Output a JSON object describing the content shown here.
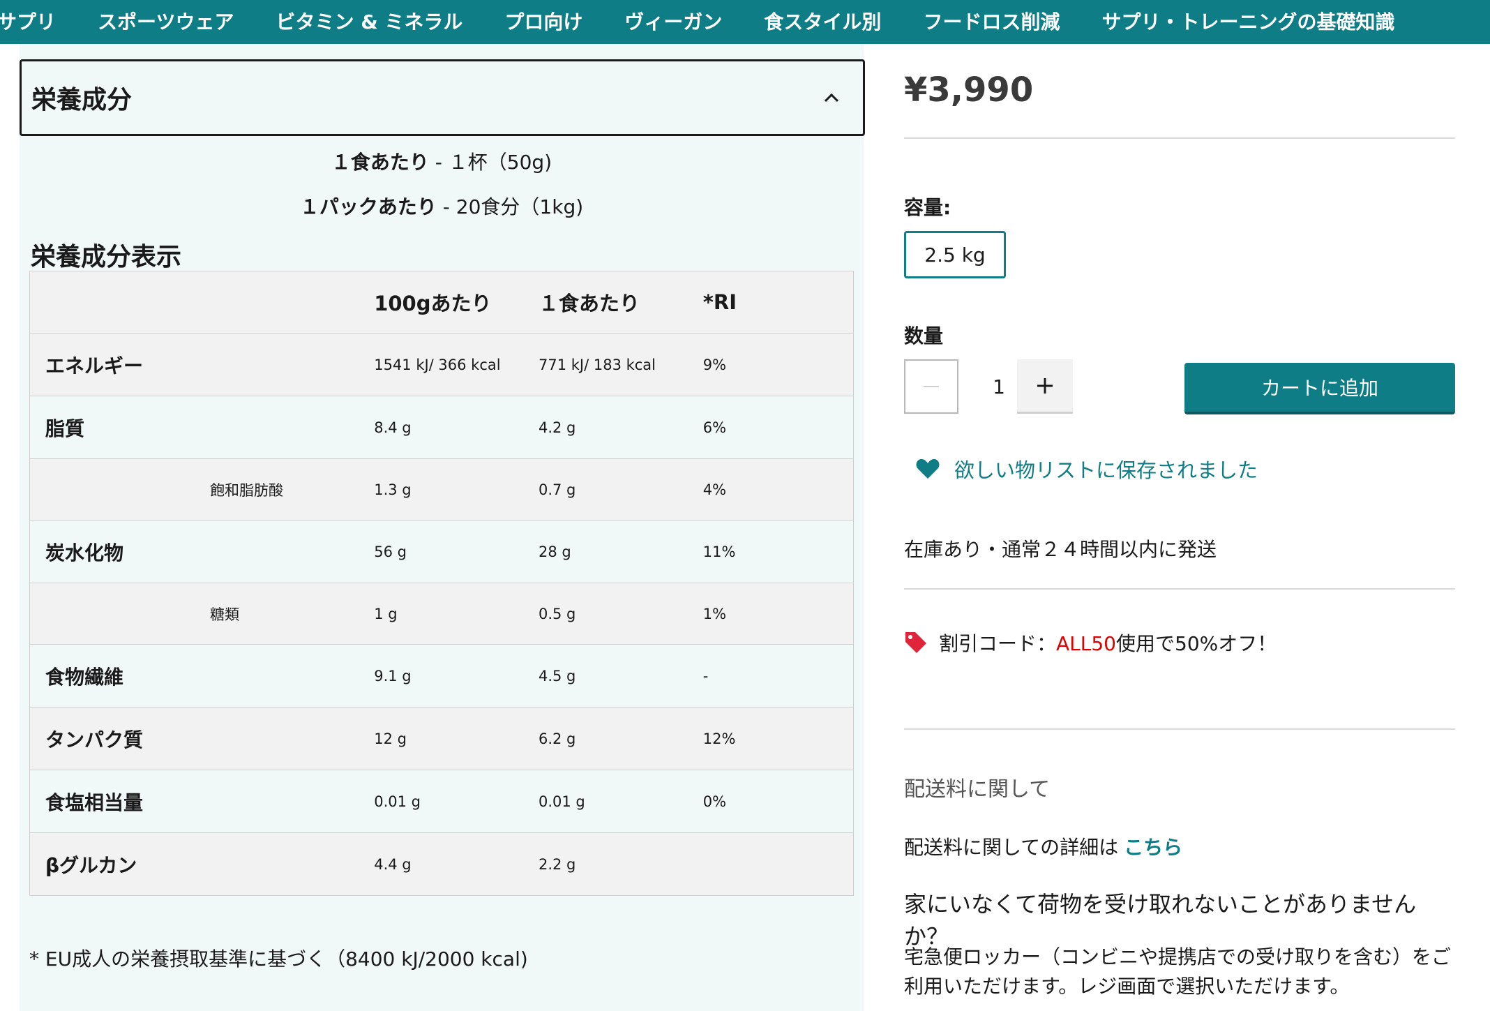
{
  "nav": {
    "items": [
      "サプリ",
      "スポーツウェア",
      "ビタミン & ミネラル",
      "プロ向け",
      "ヴィーガン",
      "食スタイル別",
      "フードロス削減",
      "サプリ・トレーニングの基礎知識"
    ]
  },
  "nutrition": {
    "title": "栄養成分",
    "serving1_bold": "１食あたり",
    "serving1_rest": " - １杯（50g)",
    "serving2_bold": "１パックあたり",
    "serving2_rest": " - 20食分（1kg)",
    "table_title": "栄養成分表示",
    "headers": [
      "",
      "100gあたり",
      "１食あたり",
      "*RI"
    ],
    "rows": [
      {
        "name": "エネルギー",
        "per100": "1541 kJ/ 366 kcal",
        "serving": "771 kJ/ 183 kcal",
        "ri": "9%"
      },
      {
        "name": "脂質",
        "per100": "8.4 g",
        "serving": "4.2 g",
        "ri": "6%"
      },
      {
        "name": "飽和脂肪酸",
        "per100": "1.3 g",
        "serving": "0.7 g",
        "ri": "4%"
      },
      {
        "name": "炭水化物",
        "per100": "56 g",
        "serving": "28 g",
        "ri": "11%"
      },
      {
        "name": "糖類",
        "per100": "1 g",
        "serving": "0.5 g",
        "ri": "1%"
      },
      {
        "name": "食物繊維",
        "per100": "9.1 g",
        "serving": "4.5 g",
        "ri": "-"
      },
      {
        "name": "タンパク質",
        "per100": "12 g",
        "serving": "6.2 g",
        "ri": "12%"
      },
      {
        "name": "食塩相当量",
        "per100": "0.01 g",
        "serving": "0.01 g",
        "ri": "0%"
      },
      {
        "name": "βグルカン",
        "per100": "4.4 g",
        "serving": "2.2 g",
        "ri": ""
      }
    ],
    "footnote": "* EU成人の栄養摂取基準に基づく（8400 kJ/2000 kcal)"
  },
  "product": {
    "price": "¥3,990",
    "size_label": "容量:",
    "size_value": "2.5 kg",
    "qty_label": "数量",
    "qty_value": "1",
    "qty_minus": "−",
    "qty_plus": "+",
    "add_to_cart": "カートに追加",
    "wishlist_text": "欲しい物リストに保存されました",
    "stock_text": "在庫あり・通常２４時間以内に発送",
    "discount_prefix": "割引コード：",
    "discount_code": "ALL50",
    "discount_suffix": "使用で50%オフ！",
    "shipping_title": "配送料に関して",
    "shipping_detail": "配送料に関しての詳細は",
    "shipping_link": "こちら",
    "locker_question": "家にいなくて荷物を受け取れないことがありませんか？",
    "locker_desc": "宅急便ロッカー（コンビニや提携店での受け取りを含む）をご利用いただけます。レジ画面で選択いただけます。"
  },
  "colors": {
    "brand": "#0f7d85",
    "discount_code": "#e00000",
    "panel_bg": "#f1f8f8"
  },
  "icons": {
    "accordion": "chevron-up-icon",
    "wishlist": "heart-icon",
    "discount": "tag-icon"
  }
}
